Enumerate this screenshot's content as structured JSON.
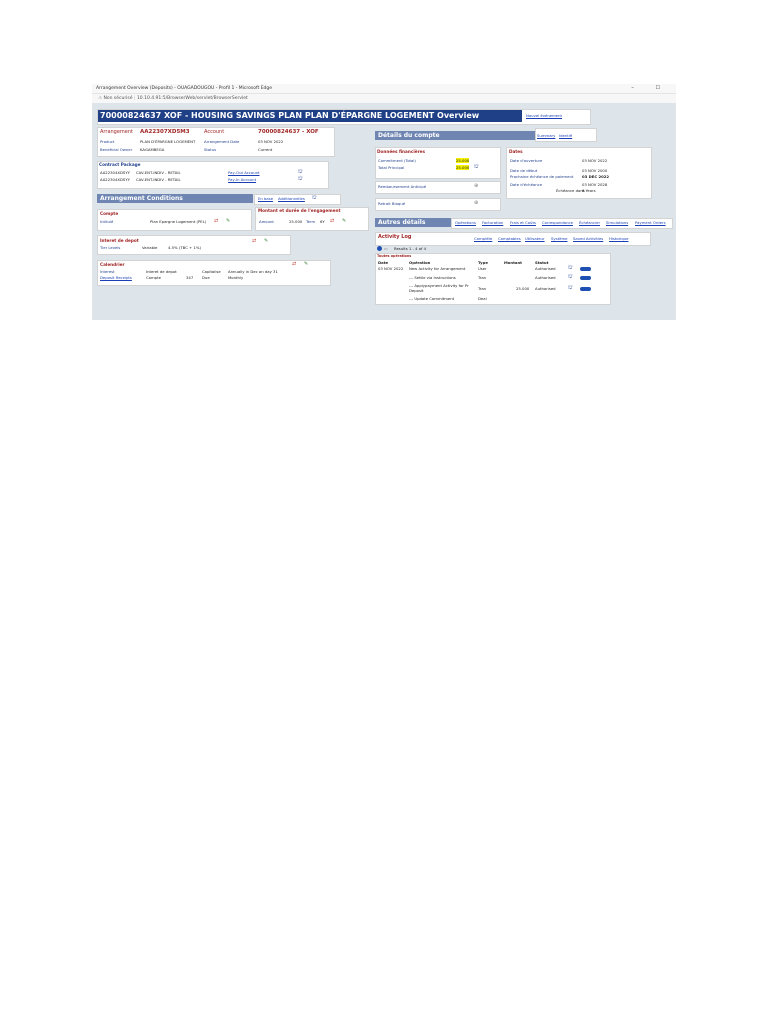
{
  "window": {
    "title": "Arrangement Overview (Deposits) - OUAGADOUGOU - Profil 1 - Microsoft Edge",
    "controls": "– ☐",
    "security": "Non sécurisé",
    "url": "10.10.4.91:5/BrowserWeb/servlet/BrowserServlet"
  },
  "header": {
    "title": "70000824637 XOF - HOUSING SAVINGS PLAN PLAN D'ÉPARGNE LOGEMENT Overview",
    "new_event_link": "Nouvel événement"
  },
  "arrangement": {
    "arrangement_label": "Arrangement",
    "arrangement_value": "AA22307XD5M3",
    "account_label": "Account",
    "account_value": "70000824637 - XOF",
    "product_label": "Product",
    "product_value": "PLAN D'ÉPARGNE LOGEMENT",
    "arrangement_date_label": "Arrangement Date",
    "arrangement_date_value": "03 NOV 2022",
    "beneficial_owner_label": "Beneficial Owner",
    "beneficial_owner_value": "KAGAMBEGA",
    "status_label": "Status",
    "status_value": "Current"
  },
  "contract_package": {
    "title": "Contract Package",
    "rows": [
      {
        "code": "AA22304XDSYY",
        "name": "CAV-ENT-INDIV - RETAIL",
        "link": "Pay-Out Account"
      },
      {
        "code": "AA22304XDSYY",
        "name": "CAV-ENT-INDIV - RETAIL",
        "link": "Pay-In Account"
      }
    ]
  },
  "arrangement_conditions": {
    "title": "Arrangement Conditions",
    "link1": "En base",
    "link2": "Additionnelles"
  },
  "compte": {
    "title": "Compte",
    "intitule_label": "Intitulé",
    "intitule_value": "Plan Epargne Logement (PEL)"
  },
  "montant_duree": {
    "title": "Montant et durée de l'engagement",
    "amount_label": "Amount",
    "amount_value": "25.000",
    "term_label": "Term",
    "term_value": "6Y"
  },
  "interet_depot": {
    "title": "Interet de depot",
    "tier_label": "Tier Levels",
    "tier_value": "Variable",
    "rate_value": "4.5% (TBC + 1%)"
  },
  "calendrier": {
    "title": "Calendrier",
    "rows": [
      {
        "label": "Interest",
        "c1": "Interet de depot",
        "c2": "",
        "c3": "Capitalise",
        "c4": "Annually in Dec on day 31"
      },
      {
        "label": "Deposit Receipts",
        "c1": "Compte",
        "c2": "347",
        "c3": "Due",
        "c4": "Monthly"
      }
    ]
  },
  "details_compte": {
    "title": "Détails du compte",
    "link1": "Summary",
    "link2": "Identifi"
  },
  "donnees_financieres": {
    "title": "Données financières",
    "commitment_label": "Commitment (Total)",
    "commitment_value": "25.000",
    "principal_label": "Total Principal",
    "principal_value": "25.000"
  },
  "dates": {
    "title": "Dates",
    "rows": [
      {
        "label": "Date d'ouverture",
        "value": "03 NOV 2022"
      },
      {
        "label": "Date de début",
        "value": "03 NOV 2000"
      },
      {
        "label": "Prochaine échéance de paiement",
        "value": "03 DEC 2022"
      },
      {
        "label": "Date d'échéance",
        "value": "03 NOV 2028"
      },
      {
        "label": "Échéance dans",
        "value": "6 Years"
      }
    ]
  },
  "remboursement": {
    "label": "Remboursement Anticipé"
  },
  "retrait": {
    "label": "Retrait Bloqué"
  },
  "autres_details": {
    "title": "Autres détails",
    "links": [
      "Opérations",
      "Facturation",
      "Frais et Coûts",
      "Correspondance",
      "Échéancier",
      "Simulations",
      "Payment Orders"
    ]
  },
  "activity_log": {
    "title": "Activity Log",
    "links": [
      "Complète",
      "Comptables",
      "Utilisateur",
      "Système",
      "Saved Activities",
      "Historique"
    ],
    "results": "Results 1 - 4 of 4",
    "section": "Toutes opérations",
    "headers": {
      "date": "Date",
      "operation": "Opération",
      "type": "Type",
      "amount": "Montant",
      "status": "Statut"
    },
    "rows": [
      {
        "date": "03 NOV 2022",
        "operation": "New Activity for Arrangement",
        "type": "User",
        "amount": "",
        "status": "Authorised"
      },
      {
        "date": "",
        "operation": "--- Settle via Instructions",
        "type": "Tran",
        "amount": "",
        "status": "Authorised"
      },
      {
        "date": "",
        "operation": "--- Applypayment Activity for Pr Deposit",
        "type": "Tran",
        "amount": "25.000",
        "status": "Authorised"
      },
      {
        "date": "",
        "operation": "--- Update Commitment",
        "type": "Deal",
        "amount": "",
        "status": ""
      }
    ]
  },
  "icons": {
    "binoculars": "⛫",
    "edit": "✎",
    "sync": "⇄",
    "zoom": "⊕"
  },
  "colors": {
    "title_bar": "#1f3f86",
    "section_header": "#6f86b2",
    "highlight": "#f4f200",
    "label_red": "#a02525",
    "link_blue": "#1a3fb5"
  }
}
